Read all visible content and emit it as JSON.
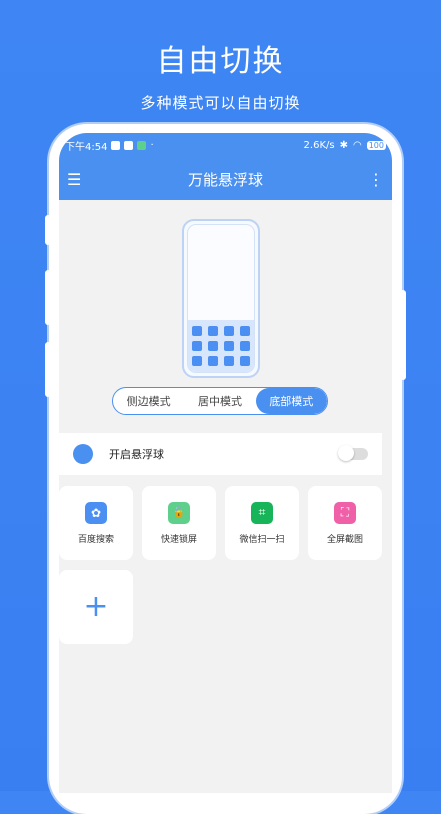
{
  "hero": {
    "title": "自由切换",
    "subtitle": "多种模式可以自由切换"
  },
  "status_bar": {
    "time": "下午4:54",
    "dot": "·",
    "speed": "2.6K/s",
    "bluetooth": "✱",
    "battery": "100"
  },
  "app_bar": {
    "title": "万能悬浮球",
    "menu_icon": "☰",
    "more_icon": "⋮"
  },
  "mode_tabs": {
    "items": [
      "侧边模式",
      "居中模式",
      "底部模式"
    ],
    "selected": "底部模式"
  },
  "float_ball": {
    "label": "开启悬浮球",
    "enabled": false
  },
  "shortcuts": [
    {
      "label": "百度搜索",
      "icon": "baidu-icon",
      "glyph": "✿",
      "color": "#4a8ff1"
    },
    {
      "label": "快速锁屏",
      "icon": "lock-icon",
      "glyph": "🔓",
      "color": "#5fcf8c"
    },
    {
      "label": "微信扫一扫",
      "icon": "scan-icon",
      "glyph": "⌗",
      "color": "#18b45a"
    },
    {
      "label": "全屏截图",
      "icon": "screenshot-icon",
      "glyph": "⛶",
      "color": "#f060a8"
    }
  ],
  "add_button": {
    "glyph": "+"
  },
  "colors": {
    "accent": "#4a90f0",
    "background": "#3f86f4"
  }
}
